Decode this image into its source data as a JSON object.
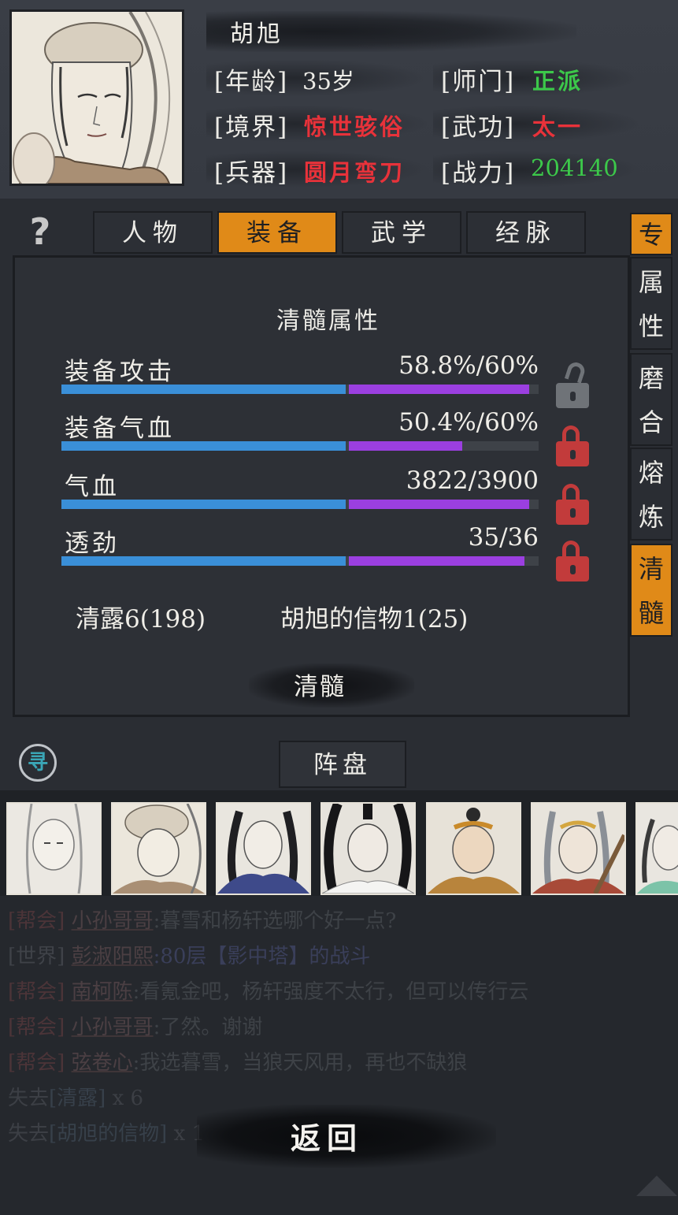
{
  "character": {
    "name": "胡旭",
    "age_label": "[年龄]",
    "age_value": "35岁",
    "sect_label": "[师门]",
    "sect_value": "正派",
    "realm_label": "[境界]",
    "realm_value": "惊世骇俗",
    "skill_label": "[武功]",
    "skill_value": "太一",
    "weapon_label": "[兵器]",
    "weapon_value": "圆月弯刀",
    "power_label": "[战力]",
    "power_value": "204140"
  },
  "colors": {
    "accent": "#e08a18",
    "red": "#e8323a",
    "green": "#3cc84a",
    "blue_bar": "#3a8fd8",
    "purple_bar": "#9b3fe0",
    "lock_red": "#c23b3b"
  },
  "help_icon": "question-icon",
  "tabs": [
    {
      "label": "人物",
      "active": false
    },
    {
      "label": "装备",
      "active": true
    },
    {
      "label": "武学",
      "active": false
    },
    {
      "label": "经脉",
      "active": false
    }
  ],
  "side_tabs": [
    {
      "label": "专",
      "active": true
    },
    {
      "label": "属性",
      "active": false
    },
    {
      "label": "磨合",
      "active": false
    },
    {
      "label": "熔炼",
      "active": false
    },
    {
      "label": "清髓",
      "active": true
    }
  ],
  "panel": {
    "title": "清髓属性",
    "stats": [
      {
        "label": "装备攻击",
        "value": "58.8%/60%",
        "base": 0.6,
        "total": 0.98,
        "locked": false
      },
      {
        "label": "装备气血",
        "value": "50.4%/60%",
        "base": 0.6,
        "total": 0.84,
        "locked": true
      },
      {
        "label": "气血",
        "value": "3822/3900",
        "base": 0.6,
        "total": 0.98,
        "locked": true
      },
      {
        "label": "透劲",
        "value": "35/36",
        "base": 0.6,
        "total": 0.97,
        "locked": true
      }
    ],
    "material_1": "清露6(198)",
    "material_2": "胡旭的信物1(25)",
    "refine_button": "清髓"
  },
  "search_icon": "寻",
  "formation_button": "阵盘",
  "chat": [
    {
      "channel": "[帮会]",
      "nick": "小孙哥哥",
      "text": ":暮雪和杨轩选哪个好一点?"
    },
    {
      "channel": "[世界]",
      "nick": "彭淑阳熙",
      "text": ":80层【影中塔】的战斗"
    },
    {
      "channel": "[帮会]",
      "nick": "南柯陈",
      "text": ":看氪金吧，杨轩强度不太行，但可以传行云"
    },
    {
      "channel": "[帮会]",
      "nick": "小孙哥哥",
      "text": ":了然。谢谢"
    },
    {
      "channel": "[帮会]",
      "nick": "弦卷心",
      "text": ":我选暮雪，当狼天风用，再也不缺狼"
    }
  ],
  "loss": [
    {
      "prefix": "失去",
      "item": "[清露]",
      "count": " x 6"
    },
    {
      "prefix": "失去",
      "item": "[胡旭的信物]",
      "count": " x 1"
    }
  ],
  "back_button": "返回"
}
